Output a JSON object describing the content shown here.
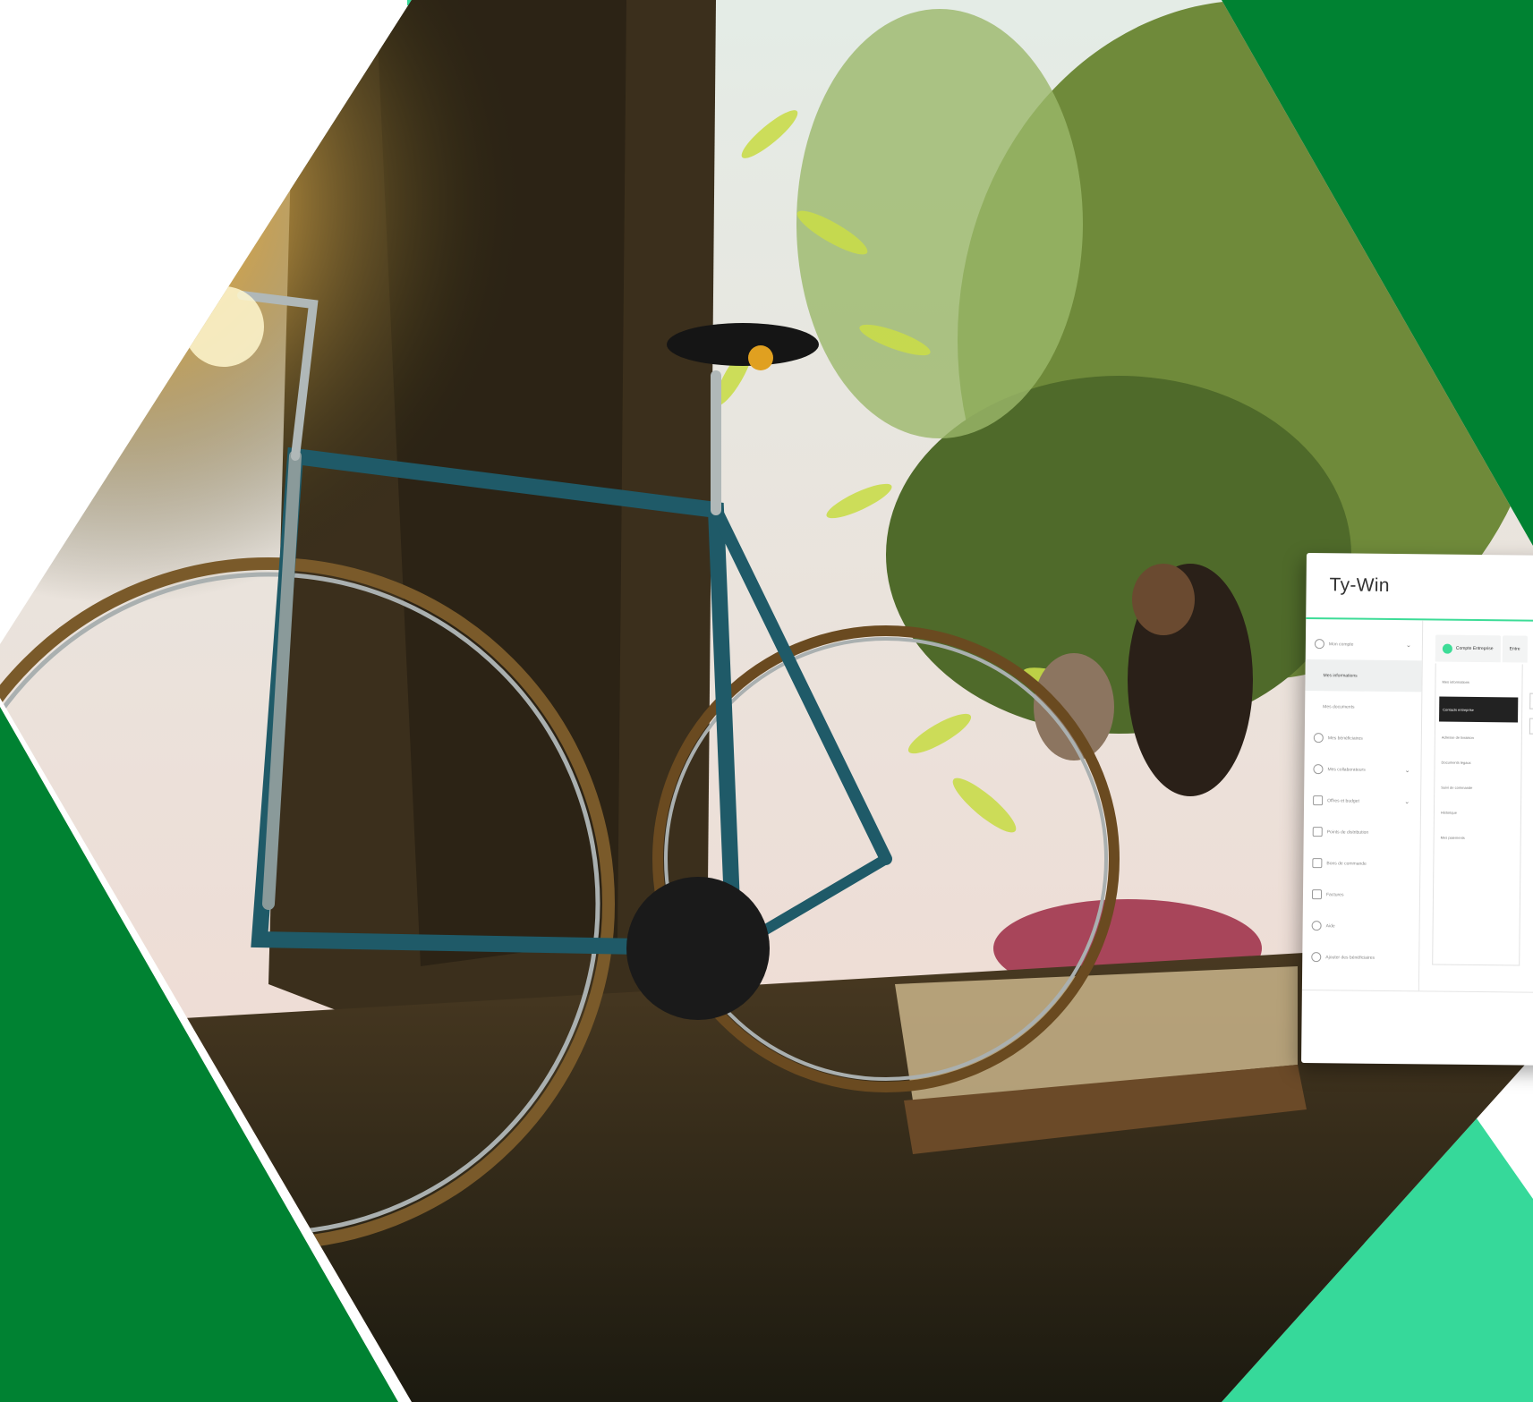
{
  "colors": {
    "dark_green": "#008232",
    "mint_green": "#36d99a",
    "white": "#ffffff"
  },
  "photo": {
    "subject": "vintage road bicycle leaning against a tree trunk, people relaxing in the background"
  },
  "app": {
    "logo": "Ty-Win",
    "sidebar": {
      "items": [
        {
          "label": "Mon compte",
          "icon": "user-icon"
        },
        {
          "label": "Mes informations",
          "icon": ""
        },
        {
          "label": "Mes documents",
          "icon": ""
        },
        {
          "label": "Mes bénéficiaires",
          "icon": "people-icon"
        },
        {
          "label": "Mes collaborateurs",
          "icon": "team-icon"
        },
        {
          "label": "Offres et budget",
          "icon": "chart-icon"
        },
        {
          "label": "Points de distribution",
          "icon": "store-icon"
        },
        {
          "label": "Bons de commande",
          "icon": "clipboard-icon"
        },
        {
          "label": "Factures",
          "icon": "invoice-icon"
        },
        {
          "label": "Aide",
          "icon": "help-icon"
        },
        {
          "label": "Ajouter des bénéficiaires",
          "icon": "share-icon"
        }
      ]
    },
    "tabs": [
      {
        "label": "Compte Entreprise"
      },
      {
        "label": "Entre"
      }
    ],
    "subnav": [
      "Mes informations",
      "Contacts entreprise",
      "Adresse de livraison",
      "Documents légaux",
      "Suivi de commande",
      "Historique",
      "Mes paiements"
    ]
  }
}
